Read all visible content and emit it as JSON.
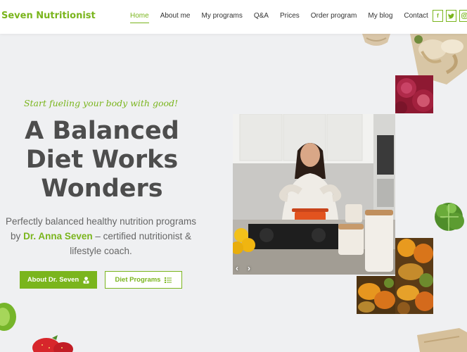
{
  "header": {
    "logo": "Seven Nutritionist",
    "nav": [
      {
        "label": "Home",
        "active": true
      },
      {
        "label": "About me"
      },
      {
        "label": "My programs"
      },
      {
        "label": "Q&A"
      },
      {
        "label": "Prices"
      },
      {
        "label": "Order program"
      },
      {
        "label": "My blog"
      },
      {
        "label": "Contact"
      }
    ],
    "social": [
      {
        "icon": "facebook-icon",
        "glyph": "f"
      },
      {
        "icon": "twitter-icon",
        "glyph": "t"
      },
      {
        "icon": "instagram-icon",
        "glyph": "◎"
      }
    ]
  },
  "hero": {
    "tagline": "Start fueling your body with good!",
    "headline": [
      "A Balanced",
      "Diet Works",
      "Wonders"
    ],
    "intro_before": "Perfectly balanced healthy nutrition programs by",
    "intro_name": "Dr. Anna Seven",
    "intro_after": "– certified nutritionist & lifestyle coach.",
    "buttons": {
      "about": "About Dr. Seven",
      "programs": "Diet Programs"
    }
  },
  "slider": {
    "prev": "‹",
    "next": "›"
  },
  "colors": {
    "accent": "#7ab51d",
    "heading": "#4d4d4d",
    "background": "#eff0f2"
  }
}
